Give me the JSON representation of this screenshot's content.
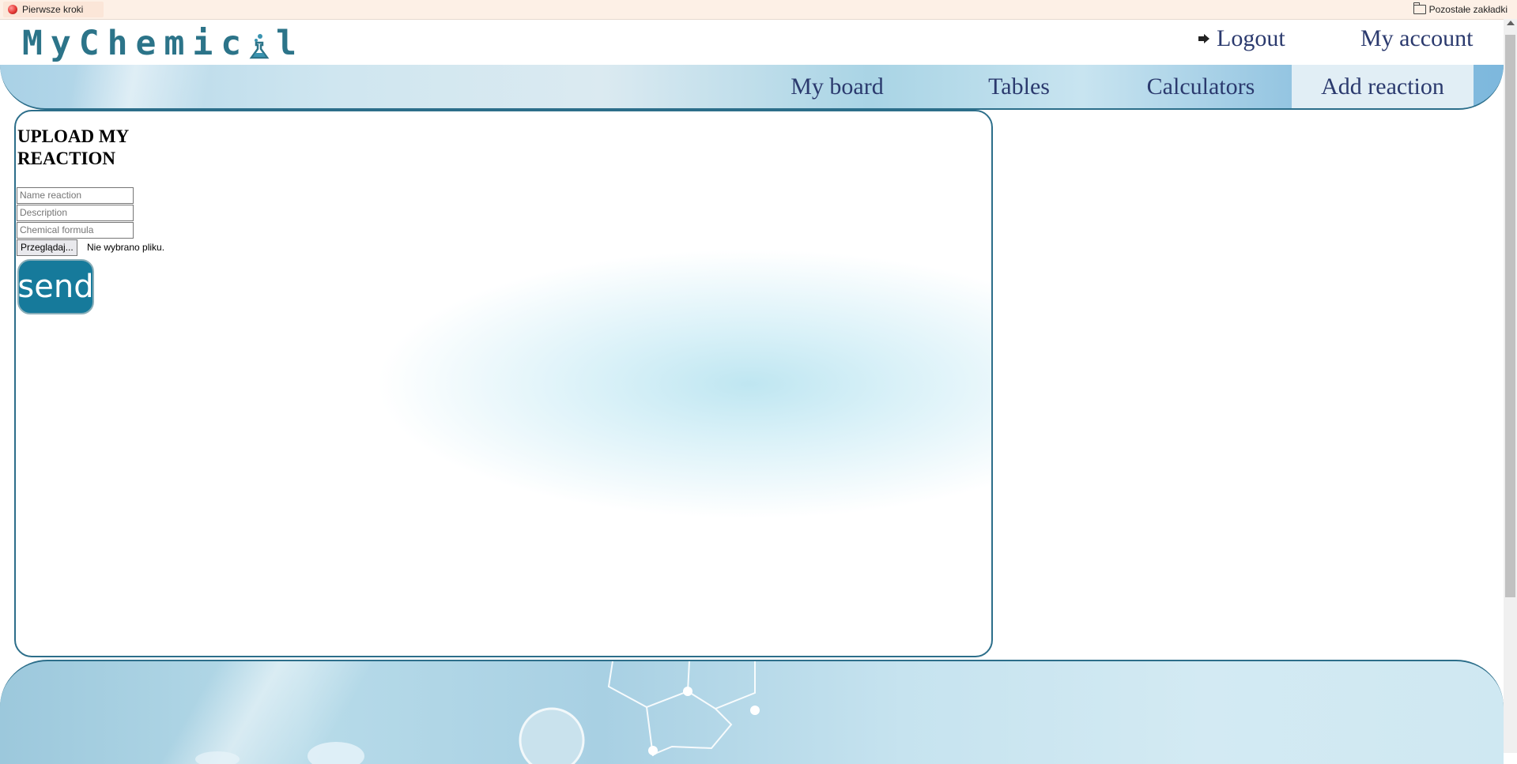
{
  "browser": {
    "bookmark_left": "Pierwsze kroki",
    "bookmark_right": "Pozostałe zakładki"
  },
  "header": {
    "logo_text": "MyChemical",
    "logout_label": "Logout",
    "account_label": "My account"
  },
  "nav": {
    "items": [
      {
        "label": "My board"
      },
      {
        "label": "Tables"
      },
      {
        "label": "Calculators"
      },
      {
        "label": "Add reaction"
      }
    ],
    "active": "Add reaction"
  },
  "form": {
    "title": "UPLOAD MY REACTION",
    "name_placeholder": "Name reaction",
    "description_placeholder": "Description",
    "formula_placeholder": "Chemical formula",
    "browse_label": "Przeglądaj...",
    "file_status": "Nie wybrano pliku.",
    "send_label": "send"
  },
  "theme": {
    "accent": "#167a9b",
    "nav_text": "#2b3a6e",
    "border": "#2c6e8a"
  }
}
